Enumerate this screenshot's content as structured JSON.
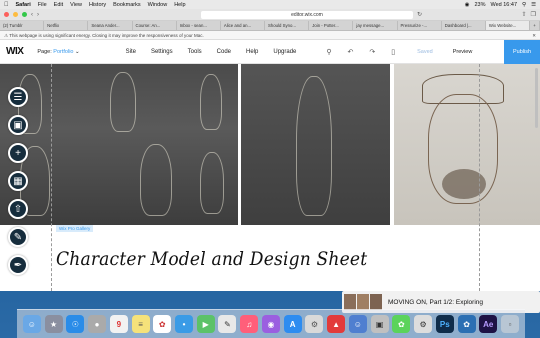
{
  "menubar": {
    "app_name": "Safari",
    "items": [
      "File",
      "Edit",
      "View",
      "History",
      "Bookmarks",
      "Window",
      "Help"
    ],
    "battery": "23%",
    "clock": "Wed 16:47"
  },
  "browser": {
    "address": "editor.wix.com",
    "tabs": [
      "(2) Tumblr",
      "Netflix",
      "Seana Ander...",
      "Course: An...",
      "Inbox - sean...",
      "Alice and an...",
      "Should Syno...",
      "Join - Potter...",
      "jay message...",
      "Pressurize -...",
      "Dashboard |...",
      "Wix Website..."
    ],
    "energy_warning": "This webpage is using significant energy. Closing it may improve the responsiveness of your Mac."
  },
  "wix": {
    "logo": "WIX",
    "page_label": "Page:",
    "page_name": "Portfolio",
    "nav": [
      "Site",
      "Settings",
      "Tools",
      "Code",
      "Help",
      "Upgrade"
    ],
    "saved": "Saved",
    "preview": "Preview",
    "publish": "Publish"
  },
  "canvas": {
    "gallery_tag": "Wix Pro Gallery",
    "heading": "Character Model and Design Sheet"
  },
  "notification": {
    "text": "MOVING ON, Part 1/2: Exploring"
  },
  "colors": {
    "wix_blue": "#3899ec",
    "palette_dark": "#162d3d"
  }
}
